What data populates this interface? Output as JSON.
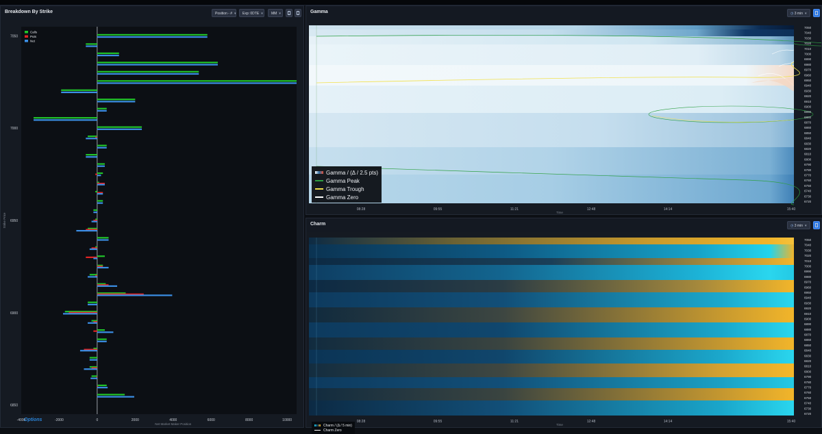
{
  "breakdown": {
    "title": "Breakdown By Strike",
    "position_select": "Position - #",
    "expiry_select": "Exp: 0DTE",
    "mode_select": "MM",
    "legend": [
      {
        "label": "Calls",
        "color": "#21c52b"
      },
      {
        "label": "Puts",
        "color": "#e02424"
      },
      {
        "label": "Net",
        "color": "#3b8fe6"
      }
    ],
    "y_tick_labels": [
      "7050",
      "7000",
      "6950",
      "6900",
      "6850"
    ],
    "x_tick_labels": [
      "-4000",
      "-2000",
      "0",
      "2000",
      "4000",
      "6000",
      "8000",
      "10000"
    ],
    "xlabel": "Net Market Maker Position",
    "ylabel": "Strike Price",
    "logo_text": "Options"
  },
  "chart_data": {
    "type": "bar",
    "orientation": "horizontal",
    "title": "Breakdown By Strike",
    "xlabel": "Net Market Maker Position",
    "ylabel": "Strike Price",
    "xlim": [
      -4000,
      10500
    ],
    "ylim": [
      6845,
      7055
    ],
    "categories": [
      7050,
      7045,
      7040,
      7035,
      7030,
      7025,
      7020,
      7015,
      7010,
      7005,
      7000,
      6995,
      6990,
      6985,
      6980,
      6975,
      6970,
      6965,
      6960,
      6955,
      6950,
      6945,
      6940,
      6935,
      6930,
      6925,
      6920,
      6915,
      6910,
      6905,
      6900,
      6895,
      6890,
      6885,
      6880,
      6875,
      6870,
      6865,
      6860,
      6855,
      6850
    ],
    "series": [
      {
        "name": "Calls",
        "values": [
          5800,
          -600,
          1150,
          6350,
          5350,
          10500,
          -1900,
          2000,
          500,
          -3350,
          2350,
          -500,
          500,
          -600,
          400,
          300,
          100,
          -100,
          300,
          -200,
          -100,
          -500,
          600,
          -100,
          400,
          300,
          -400,
          450,
          1500,
          -500,
          -1700,
          -300,
          400,
          500,
          -200,
          -400,
          -400,
          -300,
          500,
          1450,
          0
        ]
      },
      {
        "name": "Puts",
        "values": [
          0,
          0,
          0,
          0,
          0,
          0,
          0,
          0,
          0,
          0,
          0,
          -100,
          0,
          0,
          0,
          -100,
          400,
          300,
          0,
          0,
          -200,
          -600,
          0,
          -300,
          -600,
          300,
          -100,
          600,
          2450,
          0,
          -1500,
          -200,
          -200,
          0,
          -700,
          0,
          -300,
          -50,
          50,
          0,
          0
        ]
      },
      {
        "name": "Net",
        "values": [
          5800,
          -600,
          1150,
          6350,
          5350,
          10500,
          -1900,
          2000,
          500,
          -3350,
          2350,
          -600,
          500,
          -600,
          400,
          200,
          400,
          300,
          300,
          -200,
          -300,
          -1100,
          600,
          -400,
          -200,
          600,
          -500,
          1050,
          3950,
          -500,
          -1800,
          -500,
          850,
          500,
          -900,
          -400,
          -700,
          -350,
          550,
          1950,
          0
        ]
      }
    ]
  },
  "gamma": {
    "title": "Gamma",
    "interval": "3 min",
    "x_tick_labels": [
      "08:28",
      "09:55",
      "11:21",
      "12:48",
      "14:14",
      "15:40"
    ],
    "xlabel": "Time",
    "strikes": [
      "7050",
      "7040",
      "7030",
      "7020",
      "7010",
      "7000",
      "6990",
      "6980",
      "6970",
      "6960",
      "6950",
      "6940",
      "6930",
      "6920",
      "6910",
      "6900",
      "6890",
      "6880",
      "6870",
      "6860",
      "6850",
      "6840",
      "6830",
      "6820",
      "6810",
      "6800",
      "6790",
      "6780",
      "6770",
      "6760",
      "6750",
      "6740",
      "6730",
      "6720"
    ],
    "legend": [
      {
        "label": "Gamma / (Δ / 2.5 pts)",
        "kind": "gradient"
      },
      {
        "label": "Gamma Peak",
        "color": "#2ea043"
      },
      {
        "label": "Gamma Trough",
        "color": "#f2e14b"
      },
      {
        "label": "Gamma Zero",
        "color": "#ffffff"
      }
    ]
  },
  "charm": {
    "title": "Charm",
    "interval": "3 min",
    "x_tick_labels": [
      "08:28",
      "09:55",
      "11:21",
      "12:48",
      "14:14",
      "15:40"
    ],
    "xlabel": "Time",
    "strikes": [
      "7050",
      "7040",
      "7030",
      "7020",
      "7010",
      "7000",
      "6990",
      "6980",
      "6970",
      "6960",
      "6950",
      "6940",
      "6930",
      "6920",
      "6910",
      "6900",
      "6890",
      "6880",
      "6870",
      "6860",
      "6850",
      "6840",
      "6830",
      "6820",
      "6810",
      "6800",
      "6790",
      "6780",
      "6770",
      "6760",
      "6750",
      "6740",
      "6730",
      "6720"
    ],
    "legend": [
      {
        "label": "Charm / (Δ / 5 min)",
        "kind": "gradient"
      },
      {
        "label": "Charm Zero",
        "color": "#ffffff"
      }
    ]
  }
}
